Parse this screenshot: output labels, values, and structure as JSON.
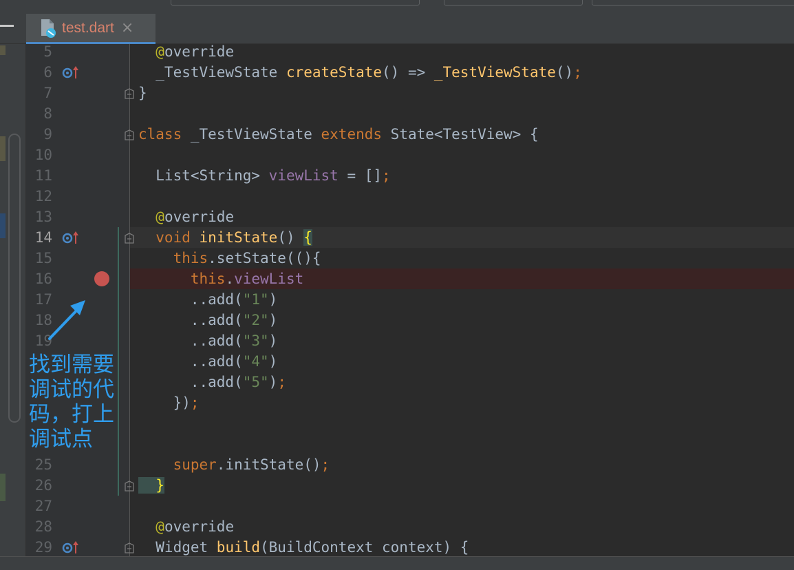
{
  "editor": {
    "tab": {
      "label": "test.dart",
      "close_symbol": "×"
    },
    "annotation": {
      "lines": [
        "找到需要",
        "调试的代",
        "码，打上",
        "调试点"
      ]
    },
    "lines": [
      {
        "number": "5",
        "segments": [
          [
            "an",
            "  @"
          ],
          [
            "",
            "override"
          ]
        ]
      },
      {
        "number": "6",
        "override_marker": true,
        "segments": [
          [
            "",
            "  _TestViewState "
          ],
          [
            "fn",
            "createState"
          ],
          [
            "",
            "() => "
          ],
          [
            "fn",
            "_TestViewState"
          ],
          [
            "",
            "()"
          ],
          [
            "kw",
            ";"
          ]
        ]
      },
      {
        "number": "7",
        "fold": true,
        "segments": [
          [
            "",
            "}"
          ]
        ]
      },
      {
        "number": "8",
        "segments": []
      },
      {
        "number": "9",
        "fold": true,
        "segments": [
          [
            "kw",
            "class "
          ],
          [
            "",
            "_TestViewState "
          ],
          [
            "kw",
            "extends "
          ],
          [
            "",
            "State<TestView> {"
          ]
        ]
      },
      {
        "number": "10",
        "segments": []
      },
      {
        "number": "11",
        "segments": [
          [
            "",
            "  List<String> "
          ],
          [
            "fd",
            "viewList"
          ],
          [
            "",
            " = []"
          ],
          [
            "kw",
            ";"
          ]
        ]
      },
      {
        "number": "12",
        "segments": []
      },
      {
        "number": "13",
        "segments": [
          [
            "an",
            "  @"
          ],
          [
            "",
            "override"
          ]
        ]
      },
      {
        "number": "14",
        "override_marker": true,
        "fold": true,
        "active": true,
        "segments": [
          [
            "kw",
            "  void "
          ],
          [
            "fn",
            "initState"
          ],
          [
            "",
            "() "
          ],
          [
            "hl",
            "{"
          ]
        ]
      },
      {
        "number": "15",
        "segments": [
          [
            "kw",
            "    this"
          ],
          [
            "",
            ".setState((){"
          ]
        ]
      },
      {
        "number": "16",
        "breakpoint": true,
        "segments": [
          [
            "kw",
            "      this"
          ],
          [
            "",
            "."
          ],
          [
            "fd",
            "viewList"
          ]
        ]
      },
      {
        "number": "17",
        "segments": [
          [
            "",
            "      ..add("
          ],
          [
            "st",
            "\"1\""
          ],
          [
            "",
            ")"
          ]
        ]
      },
      {
        "number": "18",
        "segments": [
          [
            "",
            "      ..add("
          ],
          [
            "st",
            "\"2\""
          ],
          [
            "",
            ")"
          ]
        ]
      },
      {
        "number": "19",
        "segments": [
          [
            "",
            "      ..add("
          ],
          [
            "st",
            "\"3\""
          ],
          [
            "",
            ")"
          ]
        ]
      },
      {
        "number": "",
        "segments": [
          [
            "",
            "      ..add("
          ],
          [
            "st",
            "\"4\""
          ],
          [
            "",
            ")"
          ]
        ]
      },
      {
        "number": "",
        "segments": [
          [
            "",
            "      ..add("
          ],
          [
            "st",
            "\"5\""
          ],
          [
            "",
            ")"
          ],
          [
            "kw",
            ";"
          ]
        ]
      },
      {
        "number": "",
        "segments": [
          [
            "",
            "    })"
          ],
          [
            "kw",
            ";"
          ]
        ]
      },
      {
        "number": "",
        "segments": []
      },
      {
        "number": "",
        "segments": []
      },
      {
        "number": "25",
        "segments": [
          [
            "kw",
            "    super"
          ],
          [
            "",
            ".initState()"
          ],
          [
            "kw",
            ";"
          ]
        ]
      },
      {
        "number": "26",
        "fold": true,
        "segments": [
          [
            "hl",
            "  }"
          ]
        ]
      },
      {
        "number": "27",
        "segments": []
      },
      {
        "number": "28",
        "segments": [
          [
            "an",
            "  @"
          ],
          [
            "",
            "override"
          ]
        ]
      },
      {
        "number": "29",
        "override_marker": true,
        "fold": true,
        "segments": [
          [
            "",
            "  Widget "
          ],
          [
            "fn",
            "build"
          ],
          [
            "",
            "(BuildContext context) {"
          ]
        ]
      }
    ]
  },
  "colors": {
    "background": "#2b2b2b",
    "keyword": "#cc7832",
    "function": "#ffc66d",
    "annotation_text": "#2f9ded",
    "breakpoint": "#c75450"
  }
}
